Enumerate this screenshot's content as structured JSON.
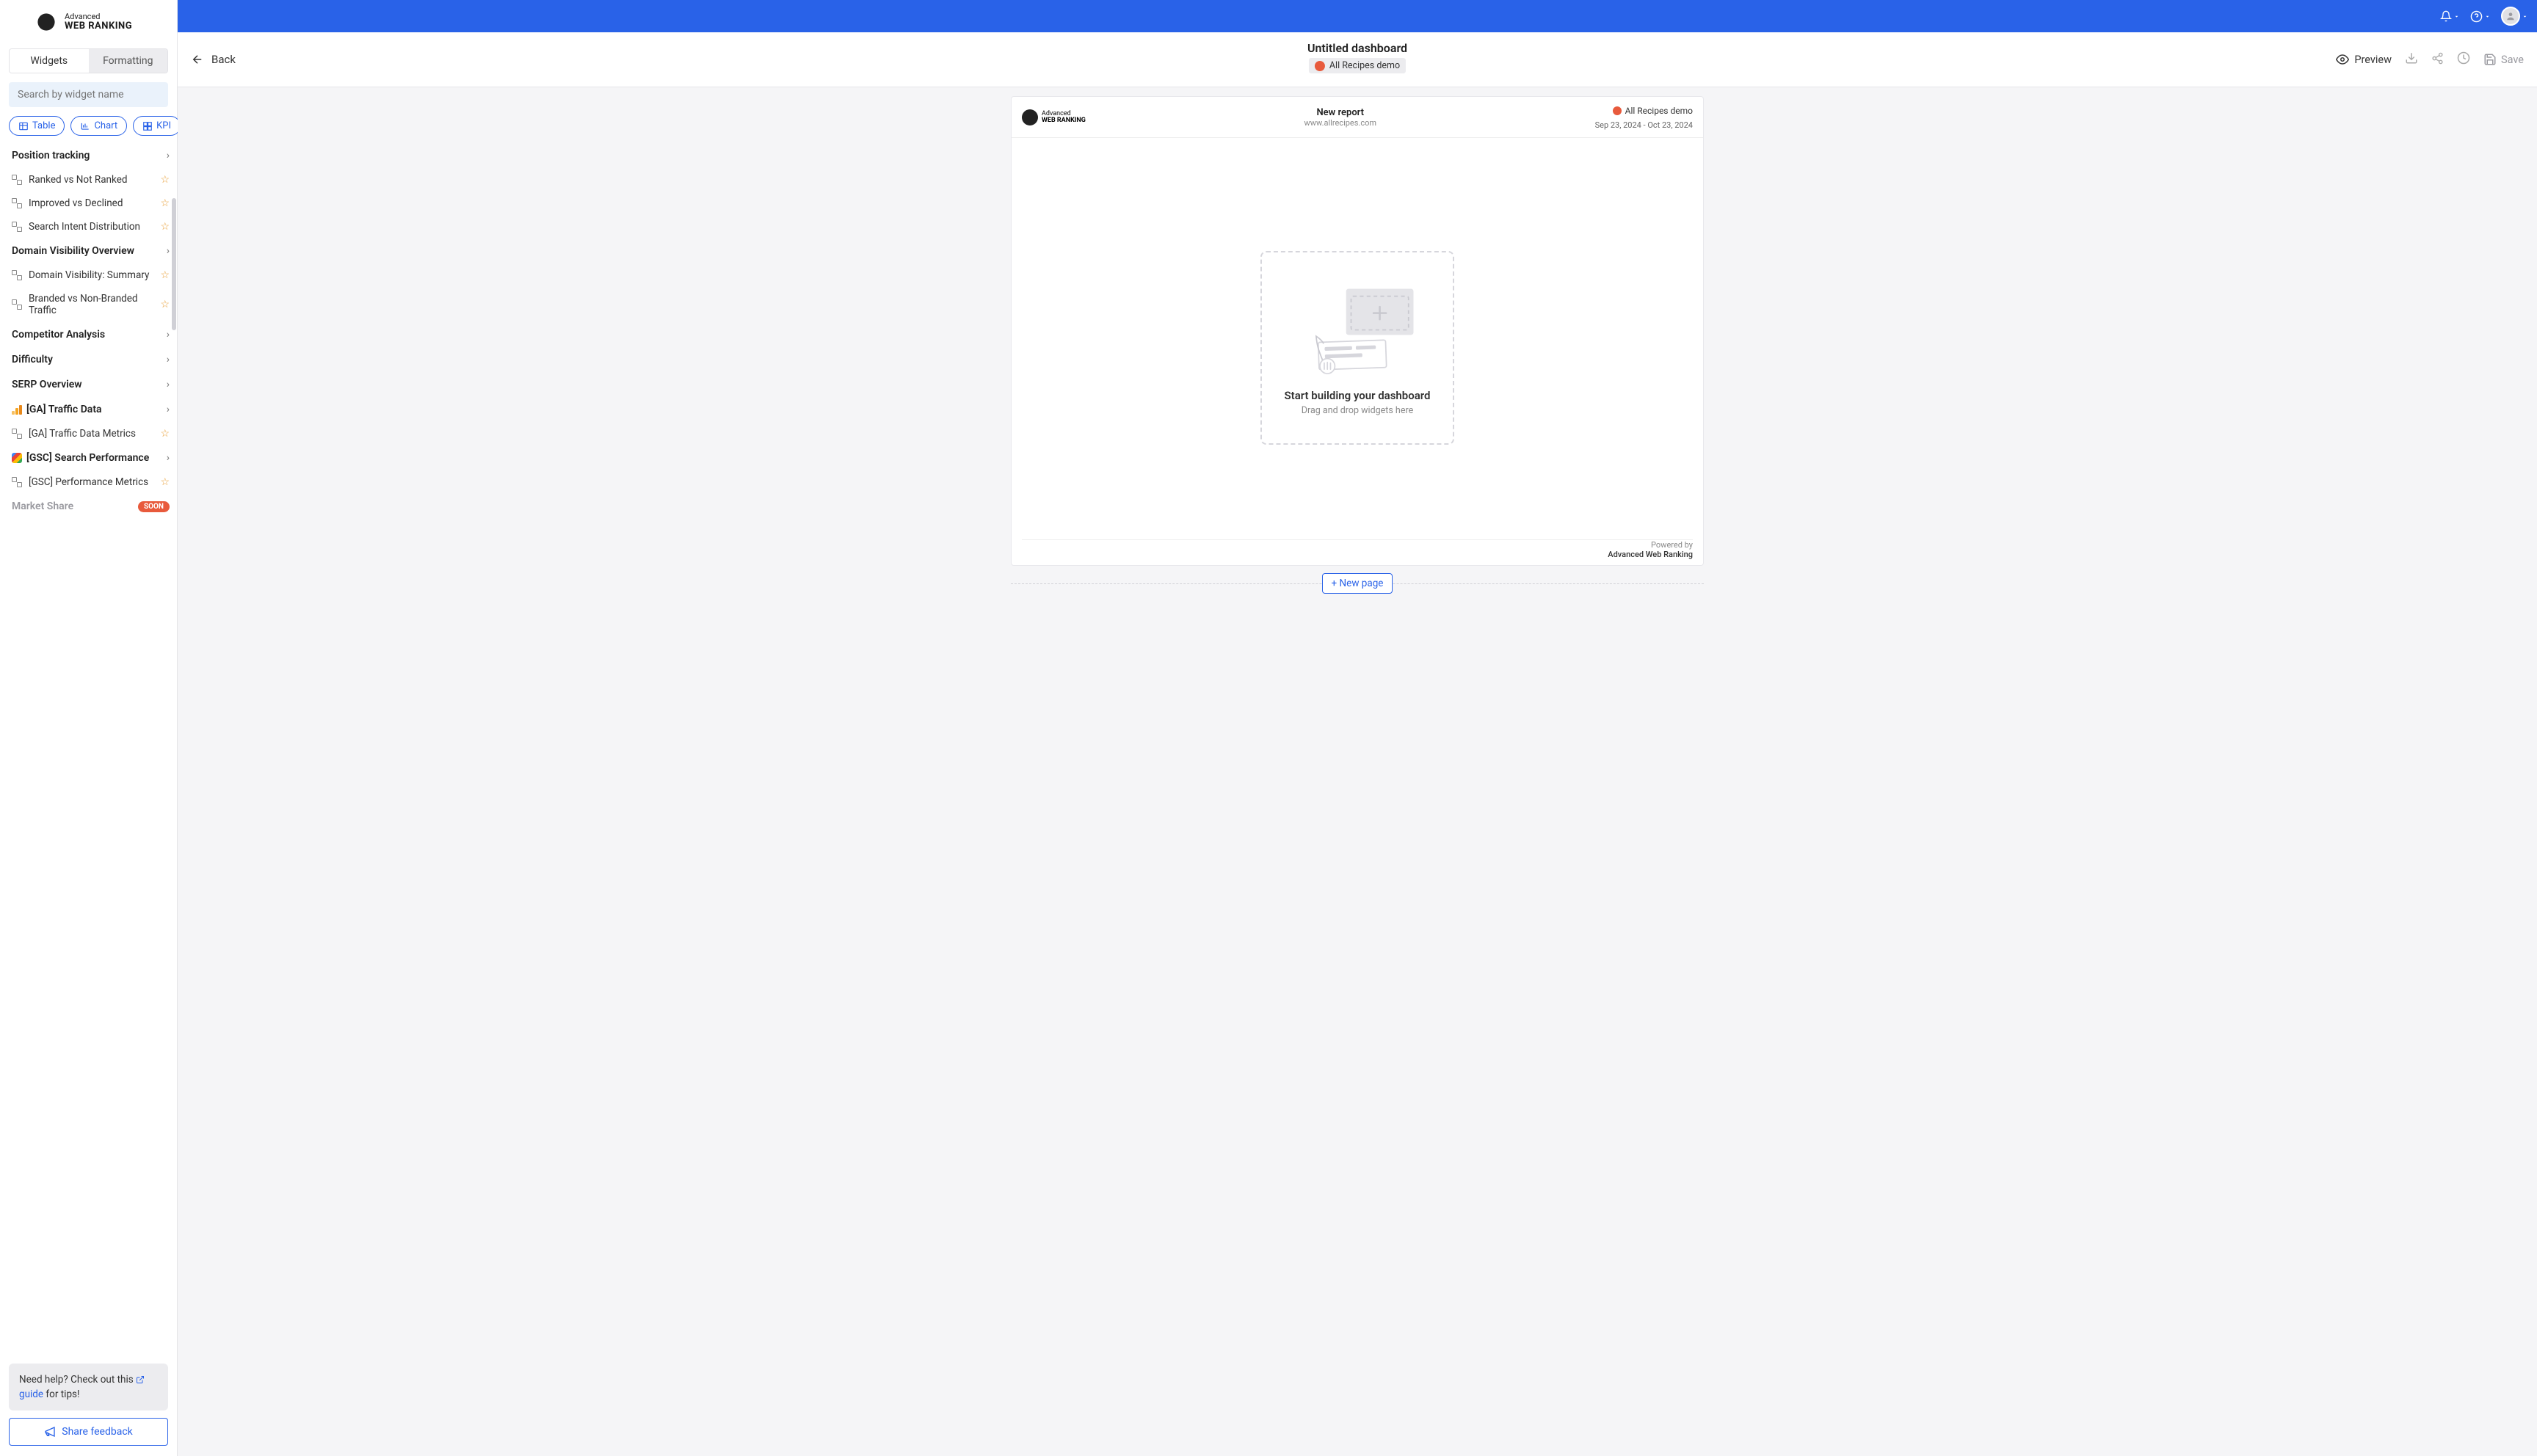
{
  "logo": {
    "line1": "Advanced",
    "line2": "WEB RANKING"
  },
  "tabs": {
    "widgets": "Widgets",
    "formatting": "Formatting"
  },
  "search": {
    "placeholder": "Search by widget name"
  },
  "typeButtons": {
    "table": "Table",
    "chart": "Chart",
    "kpi": "KPI"
  },
  "categories": {
    "position": "Position tracking",
    "domain": "Domain Visibility Overview",
    "competitor": "Competitor Analysis",
    "difficulty": "Difficulty",
    "serp": "SERP Overview",
    "ga": "[GA] Traffic Data",
    "gsc": "[GSC] Search Performance",
    "market": "Market Share"
  },
  "widgets": {
    "ranked": "Ranked vs Not Ranked",
    "improved": "Improved vs Declined",
    "intent": "Search Intent Distribution",
    "domainSummary": "Domain Visibility: Summary",
    "branded": "Branded vs Non-Branded Traffic",
    "gaMetrics": "[GA] Traffic Data Metrics",
    "gscMetrics": "[GSC] Performance Metrics"
  },
  "soon": "SOON",
  "help": {
    "prefix": "Need help? Check out this ",
    "link": "guide",
    "suffix": " for tips!"
  },
  "shareFeedback": "Share feedback",
  "header": {
    "back": "Back",
    "title": "Untitled dashboard",
    "project": "All Recipes demo",
    "preview": "Preview",
    "save": "Save"
  },
  "report": {
    "title": "New report",
    "domain": "www.allrecipes.com",
    "project": "All Recipes demo",
    "dateRange": "Sep 23, 2024 - Oct 23, 2024",
    "dropTitle": "Start building your dashboard",
    "dropSub": "Drag and drop widgets here",
    "poweredBy": "Powered by",
    "company": "Advanced Web Ranking"
  },
  "newPage": "+ New page"
}
